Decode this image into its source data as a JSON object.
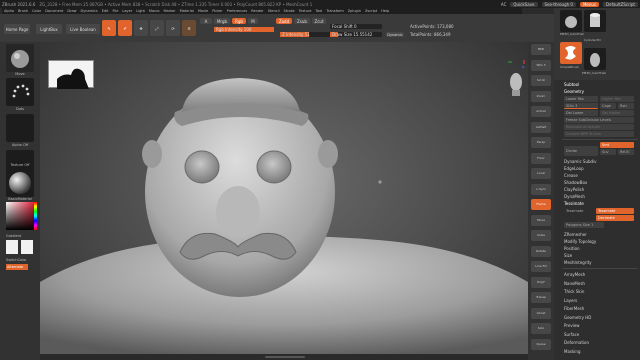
{
  "app": {
    "title": "ZBrush 2021.6.6",
    "stats": "ZG_3128 • Free Mem 25.087GB • Active Mem 838 • Scratch Disk 48 • ZTime 1.335 Timer 0.003 • PolyCount 865.822 KP • MeshCount 1"
  },
  "menus": [
    "Alpha",
    "Brush",
    "Color",
    "Document",
    "Draw",
    "Dynamics",
    "Edit",
    "File",
    "Layer",
    "Light",
    "Macro",
    "Marker",
    "Material",
    "Movie",
    "Picker",
    "Preferences",
    "Render",
    "Stencil",
    "Stroke",
    "Texture",
    "Tool",
    "Transform",
    "Zplugin",
    "Zscript",
    "Help"
  ],
  "topright": {
    "ac": "AC",
    "quicksave": "QuickSave",
    "seethrough": "See-through 0",
    "menus_label": "Menus",
    "default_script": "DefaultZScript"
  },
  "toolbar": {
    "home_page": "Home Page",
    "lightbox": "LightBox",
    "live_boolean": "Live Boolean",
    "edit": "Edit",
    "draw": "Draw",
    "move": "Move",
    "scale": "Scale",
    "rotate": "Rotate",
    "a_label": "A",
    "mrgb": "Mrgb",
    "rgb": "Rgb",
    "m": "M",
    "zadd": "Zadd",
    "zsub": "Zsub",
    "zcut": "Zcut",
    "rgb_intensity": "Rgb Intensity 100",
    "z_intensity": "Z Intensity 51",
    "focal_shift": "Focal Shift 0",
    "draw_size": "Draw Size 15.55142",
    "dynamic": "Dynamic",
    "active_points": "ActivePoints: 173,080",
    "total_points": "TotalPoints: 866,349"
  },
  "left_tray": {
    "brush_label": "Move",
    "stroke_label": "Dots",
    "alpha_label": "Alpha Off",
    "texture_label": "Texture Off",
    "material_label": "BasicMaterial",
    "gradient_label": "Gradient",
    "switch_color": "SwitchColor",
    "alternate": "Alternate"
  },
  "right_shelf": [
    "BPR",
    "SPix 3",
    "Scroll",
    "Zoom",
    "Actual",
    "AAHalf",
    "Persp",
    "Floor",
    "Local",
    "L.Sym",
    "Frame",
    "Move",
    "Scale",
    "Rotate",
    "Line Fill",
    "PolyF",
    "Transp",
    "Ghost",
    "Solo",
    "Xpose"
  ],
  "right_panel": {
    "tools": [
      {
        "label": "PM3D_CamTriall"
      },
      {
        "label": "Cylinder3D"
      },
      {
        "label": "SimpleBrush"
      },
      {
        "label": "PM3D_CamTriall"
      }
    ],
    "subtool": "Subtool",
    "geometry": "Geometry",
    "lower_res": "Lower Res",
    "higher_res": "Higher Res",
    "sdiv": "SDiv 3",
    "cage": "Cage",
    "rstr": "Rstr",
    "del_lower": "Del Lower",
    "del_higher": "Del Higher",
    "freeze_subdiv": "Freeze SubDivision Levels",
    "reconstruct_subdiv": "Reconstruct Subdiv",
    "convert_bpr": "Convert BPR To Geo",
    "divide": "Divide",
    "smt": "Smt",
    "suv": "Suv",
    "rsmt": "ReUV",
    "dynamic_subdiv": "Dynamic Subdiv",
    "edge_loop": "EdgeLoop",
    "crease": "Crease",
    "shadow_box": "ShadowBox",
    "clay_polish": "ClayPolish",
    "dyna_mesh": "DynaMesh",
    "tessimate": "Tessimate",
    "tessimate_btn": "Tessimate",
    "decimate_btn": "Decimate",
    "polygons_size": "Polygons Size 1",
    "zremesher": "ZRemesher",
    "modify_topology": "Modify Topology",
    "position": "Position",
    "size": "Size",
    "mesh_integrity": "MeshIntegrity",
    "lower_list": [
      "ArrayMesh",
      "NanoMesh",
      "Thick Skin",
      "Layers",
      "FiberMesh",
      "Geometry HD",
      "Preview",
      "Surface",
      "Deformation",
      "Masking"
    ]
  }
}
